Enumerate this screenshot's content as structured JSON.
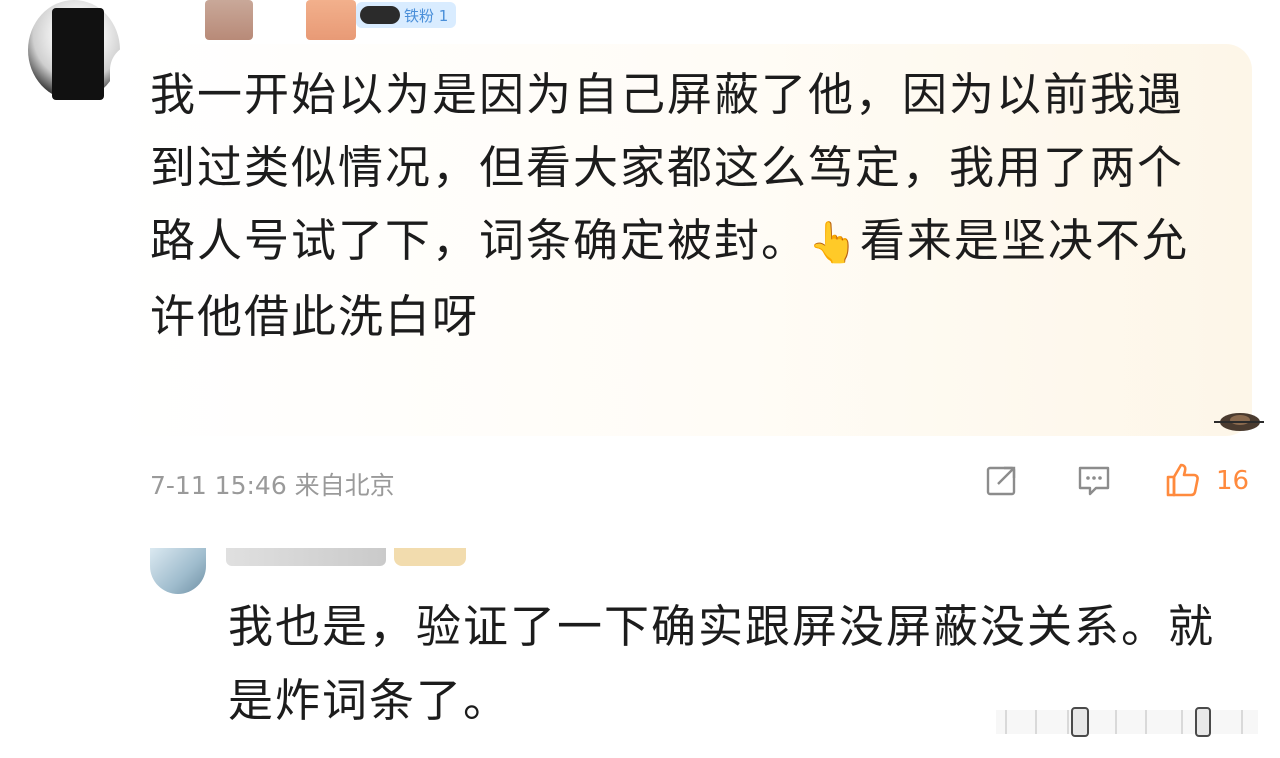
{
  "comment": {
    "badge": "铁粉 1",
    "text_part1": "我一开始以为是因为自己屏蔽了他，因为以前我遇到过类似情况，但看大家都这么笃定，我用了两个路人号试了下，词条确定被封。",
    "emoji": "👆",
    "text_part2": "看来是坚决不允许他借此洗白呀",
    "meta": "7-11 15:46 来自北京",
    "like_count": "16"
  },
  "reply": {
    "text": "我也是，验证了一下确实跟屏没屏蔽没关系。就是炸词条了。"
  },
  "colors": {
    "like": "#ff8a3d",
    "meta": "#9a9a9a",
    "badge_bg": "#d9ecff",
    "badge_text": "#4a8fd9"
  },
  "icons": [
    "share-icon",
    "comment-icon",
    "like-icon"
  ]
}
